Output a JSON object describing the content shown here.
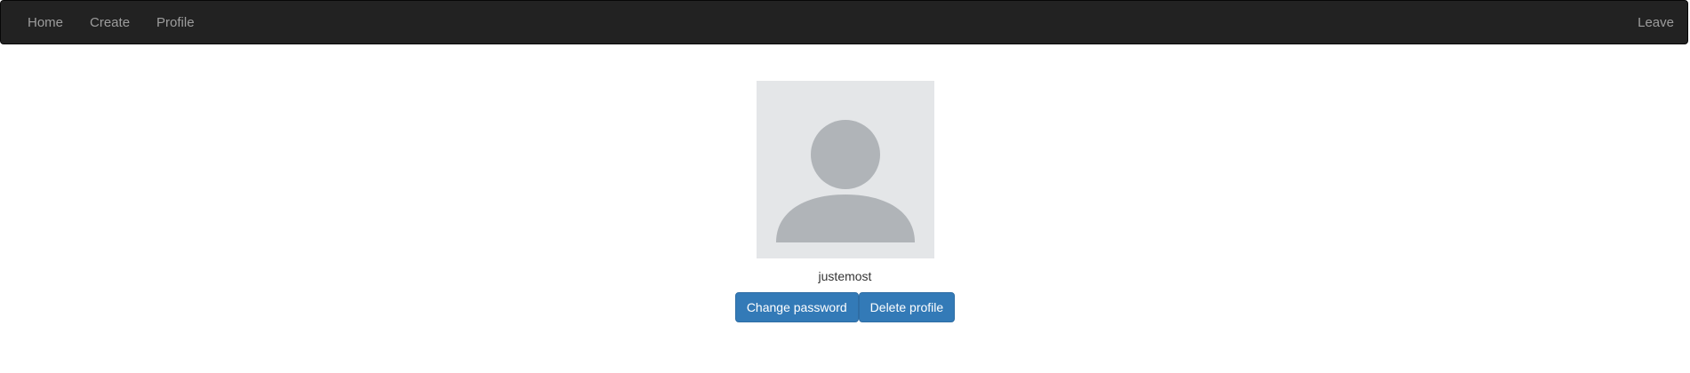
{
  "navbar": {
    "links": [
      "Home",
      "Create",
      "Profile"
    ],
    "leave_label": "Leave"
  },
  "profile": {
    "avatar_icon": "user-silhouette-icon",
    "username": "justemost",
    "change_password_label": "Change password",
    "delete_profile_label": "Delete profile"
  },
  "colors": {
    "navbar_bg": "#222222",
    "nav_link": "#9d9d9d",
    "button_primary": "#337ab7",
    "avatar_bg": "#e4e6e8",
    "avatar_silhouette": "#b0b4b8"
  }
}
